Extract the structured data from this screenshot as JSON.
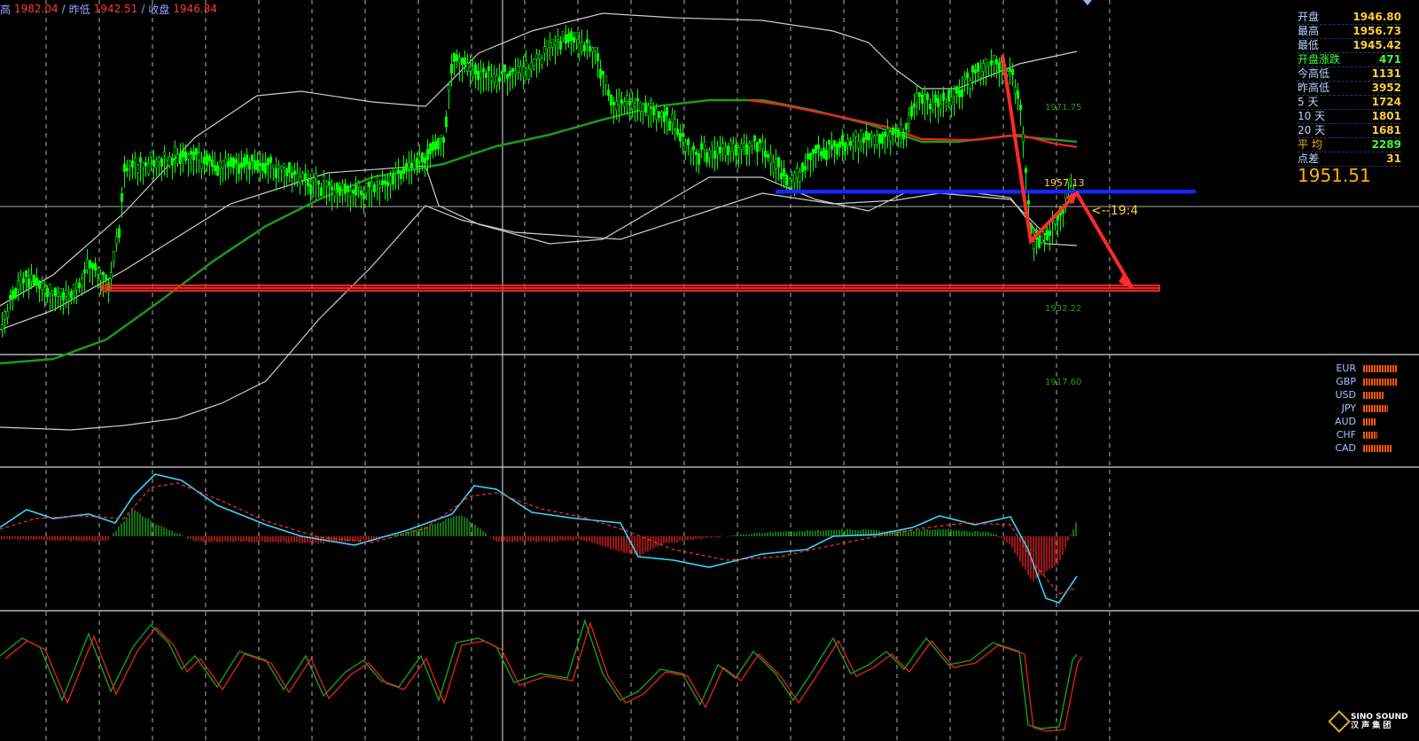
{
  "topbar": {
    "high_label": "高",
    "high_value": "1982.04",
    "sep1": "/",
    "prev_low_label": "昨低",
    "prev_low_value": "1942.51",
    "sep2": "/",
    "close_label": "收盘",
    "close_value": "1946.84"
  },
  "info_panel": {
    "rows": [
      {
        "label": "开盘",
        "value": "1946.80",
        "tone": "yellow"
      },
      {
        "label": "最高",
        "value": "1956.73",
        "tone": "yellow"
      },
      {
        "label": "最低",
        "value": "1945.42",
        "tone": "yellow"
      },
      {
        "label": "开盘涨跌",
        "value": "471",
        "tone": "green"
      },
      {
        "label": "今高低",
        "value": "1131",
        "tone": "yellow"
      },
      {
        "label": "昨高低",
        "value": "3952",
        "tone": "yellow"
      },
      {
        "label": "5  天",
        "value": "1724",
        "tone": "yellow"
      },
      {
        "label": "10 天",
        "value": "1801",
        "tone": "yellow"
      },
      {
        "label": "20 天",
        "value": "1681",
        "tone": "yellow"
      },
      {
        "label": "平  均",
        "value": "2289",
        "tone": "green"
      },
      {
        "label": "点差",
        "value": "31",
        "tone": "yellow"
      }
    ],
    "current_price": "1951.51"
  },
  "levels": {
    "l1": "1971.75",
    "l2": "1932.22",
    "l3": "1917.60",
    "marker": "1957.13",
    "note": "<--19:4"
  },
  "currencies": [
    {
      "name": "EUR",
      "strength": 0.95
    },
    {
      "name": "GBP",
      "strength": 0.95
    },
    {
      "name": "USD",
      "strength": 0.6
    },
    {
      "name": "JPY",
      "strength": 0.7
    },
    {
      "name": "AUD",
      "strength": 0.35
    },
    {
      "name": "CHF",
      "strength": 0.4
    },
    {
      "name": "CAD",
      "strength": 0.8
    }
  ],
  "logo": {
    "line1": "SINO SOUND",
    "line2": "汉 声 集 团"
  },
  "colors": {
    "background": "#000000",
    "candle": "#00ff00",
    "ma_green": "#1a9a1a",
    "ma_red": "#ff2020",
    "bollinger": "#cccccc",
    "support_red": "#ff2020",
    "resistance_blue": "#1428ff",
    "macd_line": "#3ad3ff",
    "signal_line": "#ff3030"
  }
}
